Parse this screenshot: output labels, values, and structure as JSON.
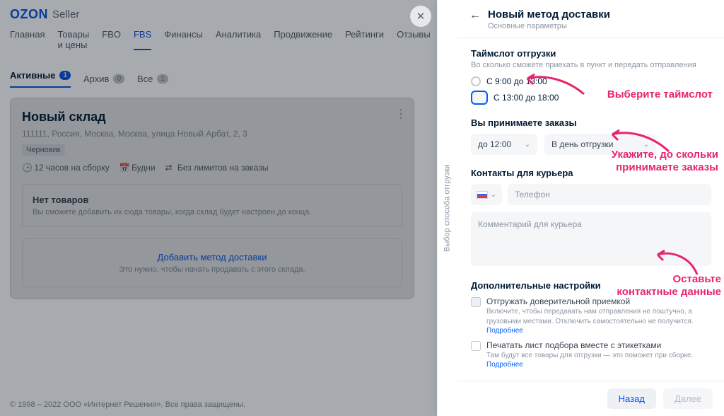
{
  "logo": {
    "brand": "OZON",
    "suffix": "Seller"
  },
  "top_nav": {
    "items": [
      "Главная",
      "Товары и цены",
      "FBO",
      "FBS",
      "Финансы",
      "Аналитика",
      "Продвижение",
      "Рейтинги",
      "Отзывы"
    ],
    "active_index": 3
  },
  "filters": {
    "active": {
      "label": "Активные",
      "count": "1"
    },
    "archive": {
      "label": "Архив",
      "count": "0"
    },
    "all": {
      "label": "Все",
      "count": "1"
    }
  },
  "warehouse": {
    "title": "Новый склад",
    "address": "111111, Россия, Москва, Москва, улица Новый Арбат, 2, 3",
    "status_tag": "Черновик",
    "assembly": "12 часов на сборку",
    "days": "Будни",
    "limits": "Без лимитов на заказы",
    "empty_title": "Нет товаров",
    "empty_hint": "Вы сможете добавить их сюда товары, когда склад будет настроен до конца.",
    "add_method": "Добавить метод доставки",
    "add_hint": "Это нужно, чтобы начать продавать с этого склада."
  },
  "footer_bg": "© 1998 – 2022 ООО «Интернет Решения». Все права защищены.",
  "panel": {
    "vtab": "Выбор способа отгрузки",
    "title": "Новый метод доставки",
    "subtitle": "Основные параметры",
    "timeslot": {
      "title": "Таймслот отгрузки",
      "hint": "Во сколько сможете приехать в пункт и передать отправления",
      "opt1": "С 9:00 до 13:00",
      "opt2": "С 13:00 до 18:00"
    },
    "accept": {
      "title": "Вы принимаете заказы",
      "until": "до 12:00",
      "day": "В день отгрузки"
    },
    "courier": {
      "title": "Контакты для курьера",
      "phone_placeholder": "Телефон",
      "comment_placeholder": "Комментарий для курьера"
    },
    "advanced": {
      "title": "Дополнительные настройки",
      "trust_label": "Отгружать доверительной приемкой",
      "trust_desc": "Включите, чтобы передавать нам отправления не поштучно, а грузовыми местами. Отключить самостоятельно не получится. ",
      "trust_link": "Подробнее",
      "print_label": "Печатать лист подбора вместе с этикетками",
      "print_desc": "Там будут все товары для отгрузки — это поможет при сборке. ",
      "print_link": "Подробнее"
    },
    "footer": {
      "back": "Назад",
      "next": "Далее"
    }
  },
  "annotations": {
    "a1": "Выберите таймслот",
    "a2_l1": "Укажите, до скольки",
    "a2_l2": "принимаете заказы",
    "a3_l1": "Оставьте",
    "a3_l2": "контактные данные"
  }
}
